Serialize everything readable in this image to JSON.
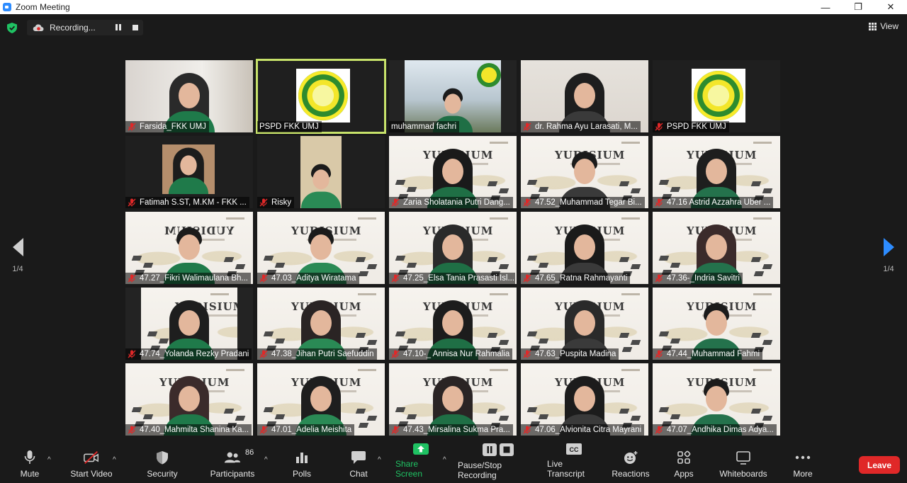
{
  "window": {
    "title": "Zoom Meeting",
    "minimize": "—",
    "restore": "❐",
    "close": "✕"
  },
  "recording": {
    "label": "Recording..."
  },
  "view": {
    "label": "View"
  },
  "pager": {
    "left_page": "1/4",
    "right_page": "1/4"
  },
  "colors": {
    "accent": "#2d8cff",
    "active_speaker": "#c7e26a",
    "share_green": "#1fc263",
    "leave_red": "#e02828",
    "muted_red": "#e02828"
  },
  "participants": [
    {
      "name": "Farsida_FKK UMJ",
      "muted": true
    },
    {
      "name": "PSPD FKK UMJ",
      "muted": false
    },
    {
      "name": "muhammad fachri",
      "muted": false
    },
    {
      "name": "dr. Rahma Ayu Larasati, M...",
      "muted": true
    },
    {
      "name": "PSPD FKK UMJ",
      "muted": true
    },
    {
      "name": "Fatimah S.ST, M.KM - FKK ...",
      "muted": true
    },
    {
      "name": "Risky",
      "muted": true
    },
    {
      "name": "Zaria Sholatania Putri Dang...",
      "muted": true
    },
    {
      "name": "47.52_Muhammad Tegar Bi...",
      "muted": true
    },
    {
      "name": "47.16 Astrid Azzahra Uber ...",
      "muted": true
    },
    {
      "name": "47.27_Fikri Walimaulana Bh...",
      "muted": true
    },
    {
      "name": "47.03_Aditya Wiratama",
      "muted": true
    },
    {
      "name": "47.25_Elsa Tania Prasasti Isl...",
      "muted": true
    },
    {
      "name": "47.65_Ratna Rahmayanti",
      "muted": true
    },
    {
      "name": "47.36-_Indria Savitri",
      "muted": true
    },
    {
      "name": "47.74_Yolanda Rezky Pradani",
      "muted": true
    },
    {
      "name": "47.38_Jihan Putri Saefuddin",
      "muted": true
    },
    {
      "name": "47.10-_ Annisa Nur Rahmalia",
      "muted": true
    },
    {
      "name": "47.63_Puspita Madina",
      "muted": true
    },
    {
      "name": "47.44_Muhammad Fahmi",
      "muted": true
    },
    {
      "name": "47.40_Mahmilta Shanina Ka...",
      "muted": true
    },
    {
      "name": "47.01_Adelia Meishita",
      "muted": true
    },
    {
      "name": "47.43_Mirsalina Sukma Pra...",
      "muted": true
    },
    {
      "name": "47.06_Alvionita Citra Mayrani",
      "muted": true
    },
    {
      "name": "47.07_Andhika Dimas Adya...",
      "muted": true
    }
  ],
  "toolbar": {
    "mute": "Mute",
    "start_video": "Start Video",
    "security": "Security",
    "participants": "Participants",
    "participants_count": "86",
    "polls": "Polls",
    "chat": "Chat",
    "share_screen": "Share Screen",
    "pause_stop_recording": "Pause/Stop Recording",
    "live_transcript": "Live Transcript",
    "reactions": "Reactions",
    "apps": "Apps",
    "whiteboards": "Whiteboards",
    "more": "More",
    "leave": "Leave",
    "cc": "CC"
  },
  "icons": {
    "shield": "shield-check-icon",
    "cloud": "cloud-record-icon",
    "grid": "grid-view-icon"
  }
}
